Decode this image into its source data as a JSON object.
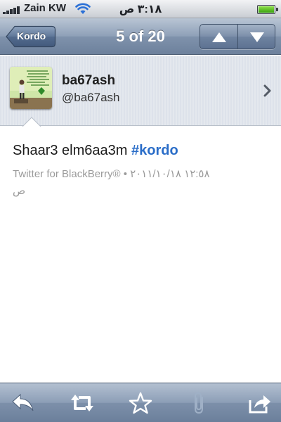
{
  "status_bar": {
    "carrier": "Zain KW",
    "time": "٣:١٨ ص",
    "battery_level": 1.0
  },
  "nav": {
    "back_label": "Kordo",
    "title": "5 of 20"
  },
  "profile": {
    "display_name": "ba67ash",
    "handle": "@ba67ash"
  },
  "tweet": {
    "text_plain": "Shaar3 elm6aa3m ",
    "hashtag": "#kordo",
    "meta_line1": "Twitter for BlackBerry® • ١٢:٥٨ ٢٠١١/١٠/١٨",
    "meta_line2": "ص"
  },
  "toolbar": {
    "icons": [
      "reply-icon",
      "retweet-icon",
      "favorite-star-icon",
      "attachment-icon",
      "share-icon"
    ]
  },
  "colors": {
    "nav_bar": "#8ea0b8",
    "hashtag": "#2a6dc8",
    "meta_text": "#9a9a9a",
    "battery_fill": "#3aa20f"
  }
}
